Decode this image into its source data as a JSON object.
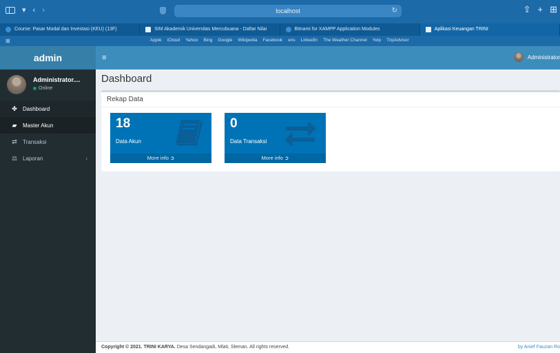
{
  "browser": {
    "url": "localhost",
    "tabs": [
      {
        "label": "Course: Pasar Modal dan Investasi (KEU) (13F)"
      },
      {
        "label": "SIM Akademik Universitas Mercubuana - Daftar Nilai"
      },
      {
        "label": "Bitnami for XAMPP Application Modules"
      },
      {
        "label": "Aplikasi Keuangan TRINI"
      }
    ],
    "bookmarks": [
      "Apple",
      "iCloud",
      "Yahoo",
      "Bing",
      "Google",
      "Wikipedia",
      "Facebook",
      "ens",
      "LinkedIn",
      "The Weather Channel",
      "Yelp",
      "TripAdvisor"
    ]
  },
  "sidebar": {
    "logo": "admin",
    "user_name": "Administrator....",
    "user_status": "Online",
    "items": [
      {
        "label": "Dashboard",
        "icon": "dashboard-icon"
      },
      {
        "label": "Master Akun",
        "icon": "book-icon"
      },
      {
        "label": "Transaksi",
        "icon": "exchange-icon"
      },
      {
        "label": "Laporan",
        "icon": "balance-scale-icon"
      }
    ]
  },
  "header": {
    "admin_name": "Administrator"
  },
  "content": {
    "title": "Dashboard",
    "box_title": "Rekap Data",
    "cards": [
      {
        "count": "18",
        "label": "Data Akun",
        "footer": "More info",
        "icon": "book-icon"
      },
      {
        "count": "0",
        "label": "Data Transaksi",
        "footer": "More info",
        "icon": "exchange-icon"
      }
    ]
  },
  "footer": {
    "copyright_prefix": "Copyright © 2021.",
    "company": "TRINI KARYA.",
    "address": "Desa Sendangadi, Mlati, Sleman. All rights reserved.",
    "credit": "by Anief Fauzan Ro"
  },
  "colors": {
    "header": "#3c8dbc",
    "logo": "#367fa9",
    "sidebar": "#222d32",
    "card": "#0073b7",
    "browser_chrome": "#1d6aa8"
  }
}
